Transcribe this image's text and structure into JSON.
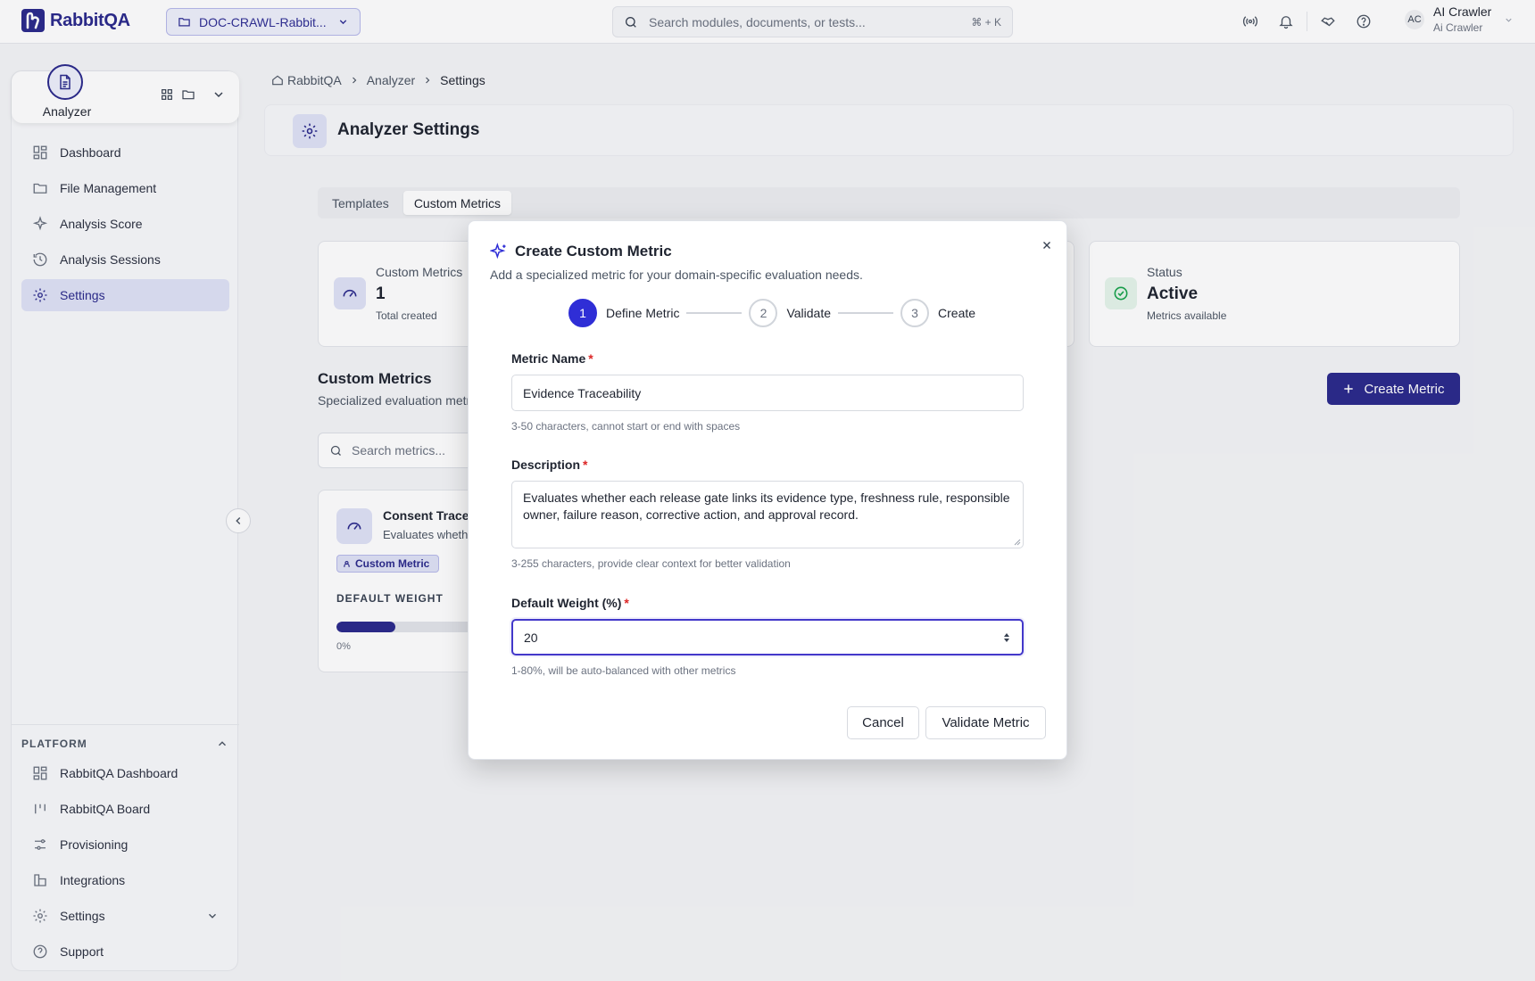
{
  "app": {
    "name": "RabbitQA"
  },
  "topbar": {
    "project": "DOC-CRAWL-Rabbit...",
    "search_placeholder": "Search modules, documents, or tests...",
    "shortcut": "⌘ + K",
    "user": {
      "initials": "AC",
      "name": "AI Crawler",
      "subtitle": "Ai Crawler"
    }
  },
  "sidebar": {
    "module": "Analyzer",
    "items": [
      {
        "label": "Dashboard",
        "icon": "dashboard-icon"
      },
      {
        "label": "File Management",
        "icon": "folder-icon"
      },
      {
        "label": "Analysis Score",
        "icon": "sparkles-icon"
      },
      {
        "label": "Analysis Sessions",
        "icon": "history-icon"
      },
      {
        "label": "Settings",
        "icon": "gear-icon",
        "active": true
      }
    ],
    "platform": {
      "heading": "PLATFORM",
      "items": [
        {
          "label": "RabbitQA Dashboard",
          "icon": "dashboard-icon"
        },
        {
          "label": "RabbitQA Board",
          "icon": "board-icon"
        },
        {
          "label": "Provisioning",
          "icon": "sliders-icon"
        },
        {
          "label": "Integrations",
          "icon": "integrations-icon"
        },
        {
          "label": "Settings",
          "icon": "gear-icon"
        },
        {
          "label": "Support",
          "icon": "help-icon"
        }
      ]
    }
  },
  "breadcrumb": [
    "RabbitQA",
    "Analyzer",
    "Settings"
  ],
  "page": {
    "title": "Analyzer Settings",
    "tabs": [
      {
        "label": "Templates",
        "active": false
      },
      {
        "label": "Custom Metrics",
        "active": true
      }
    ],
    "stats": {
      "custom": {
        "label": "Custom Metrics",
        "value": "1",
        "sub": "Total created"
      },
      "status": {
        "label": "Status",
        "value": "Active",
        "sub": "Metrics available"
      }
    },
    "section_title": "Custom Metrics",
    "section_sub": "Specialized evaluation metrics",
    "create_button": "Create Metric",
    "search_placeholder": "Search metrics...",
    "metric_card": {
      "title": "Consent Traceability",
      "subtitle": "Evaluates whether",
      "badge": "Custom Metric",
      "weight_label": "DEFAULT WEIGHT",
      "weight_fraction": 0.33,
      "min_label": "0%"
    }
  },
  "modal": {
    "title": "Create Custom Metric",
    "subtitle": "Add a specialized metric for your domain-specific evaluation needs.",
    "steps": [
      {
        "num": "1",
        "label": "Define Metric",
        "active": true
      },
      {
        "num": "2",
        "label": "Validate",
        "active": false
      },
      {
        "num": "3",
        "label": "Create",
        "active": false
      }
    ],
    "name_label": "Metric Name",
    "name_value": "Evidence Traceability",
    "name_hint": "3-50 characters, cannot start or end with spaces",
    "desc_label": "Description",
    "desc_value": "Evaluates whether each release gate links its evidence type, freshness rule, responsible owner, failure reason, corrective action, and approval record.",
    "desc_hint": "3-255 characters, provide clear context for better validation",
    "weight_label": "Default Weight (%)",
    "weight_value": "20",
    "weight_hint": "1-80%, will be auto-balanced with other metrics",
    "required_mark": "*",
    "cancel": "Cancel",
    "validate": "Validate Metric"
  },
  "colors": {
    "brand": "#2b2a8c",
    "step_active": "#2f2ed6",
    "required": "#dc2626",
    "success": "#16a34a"
  }
}
